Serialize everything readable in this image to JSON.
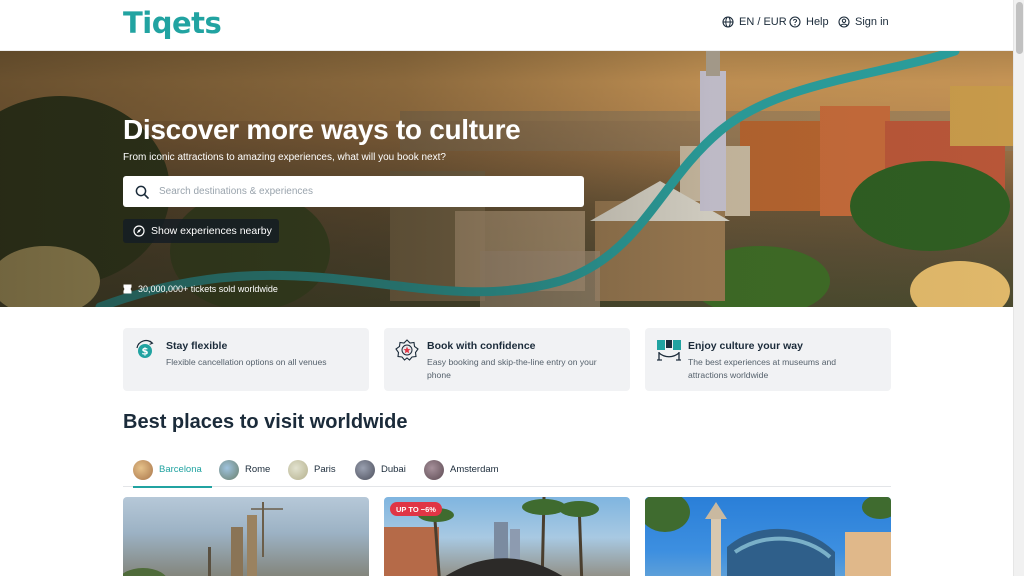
{
  "header": {
    "logo": "Tiqets",
    "language": "EN / EUR",
    "help": "Help",
    "sign_in": "Sign in"
  },
  "hero": {
    "title": "Discover more ways to culture",
    "subtitle": "From iconic attractions to amazing experiences, what will you book next?",
    "search_placeholder": "Search destinations & experiences",
    "nearby_button": "Show experiences nearby",
    "tickets_sold": "30,000,000+ tickets sold worldwide"
  },
  "usps": [
    {
      "title": "Stay flexible",
      "desc": "Flexible cancellation options on all venues",
      "icon": "cash-refresh-icon"
    },
    {
      "title": "Book with confidence",
      "desc": "Easy booking and skip-the-line entry on your phone",
      "icon": "ticket-badge-icon"
    },
    {
      "title": "Enjoy culture your way",
      "desc": "The best experiences at museums and attractions worldwide",
      "icon": "museum-rope-icon"
    }
  ],
  "best_places": {
    "title": "Best places to visit worldwide",
    "tabs": [
      {
        "label": "Barcelona",
        "active": true
      },
      {
        "label": "Rome",
        "active": false
      },
      {
        "label": "Paris",
        "active": false
      },
      {
        "label": "Dubai",
        "active": false
      },
      {
        "label": "Amsterdam",
        "active": false
      }
    ],
    "cards": [
      {
        "badge": ""
      },
      {
        "badge": "UP TO −6%"
      },
      {
        "badge": ""
      }
    ]
  },
  "colors": {
    "brand": "#21a3a1",
    "text": "#1b2b3a",
    "badge": "#e03545"
  }
}
